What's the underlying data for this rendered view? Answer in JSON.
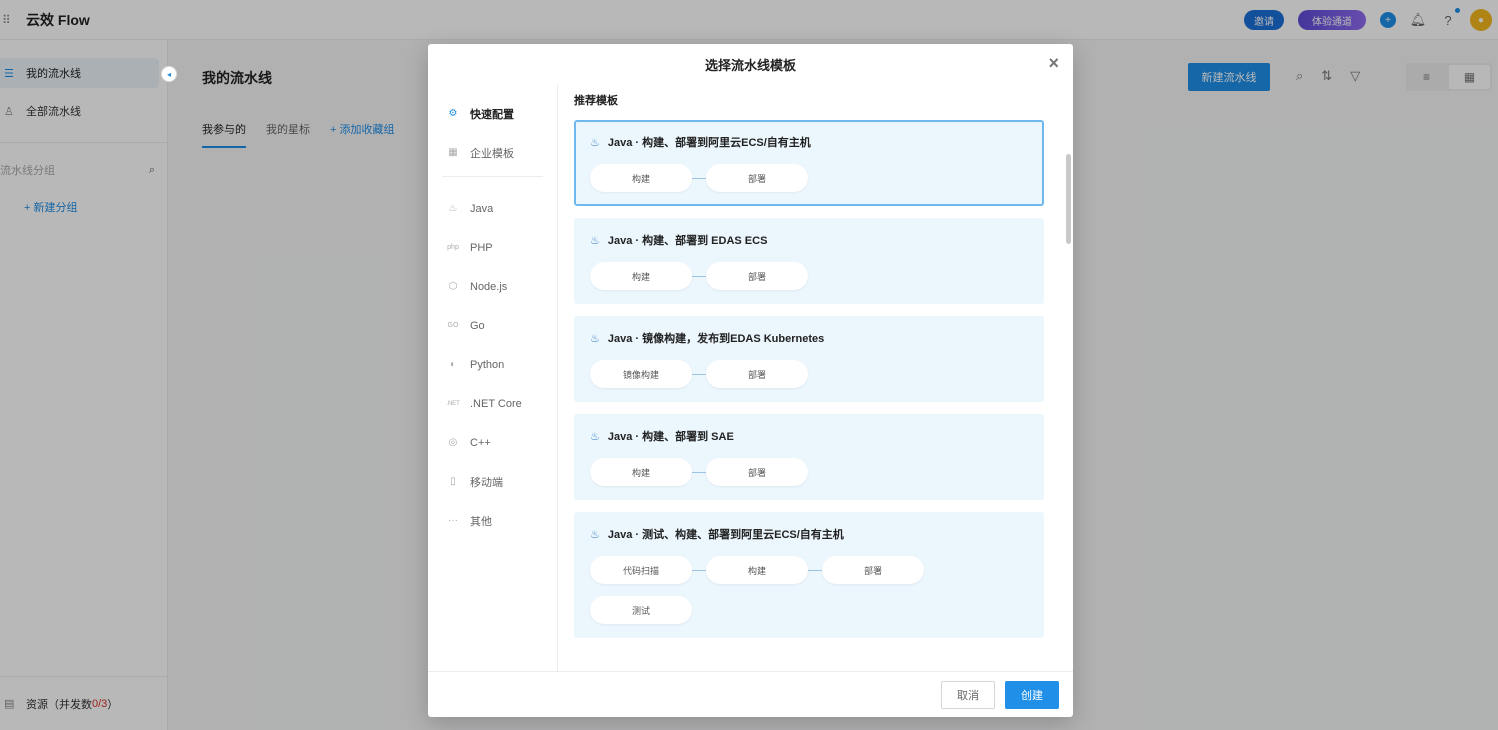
{
  "app": {
    "title": "云效 Flow"
  },
  "topbar": {
    "pill1": "邀请",
    "pill2": "体验通道"
  },
  "sidebar": {
    "items": [
      {
        "label": "我的流水线"
      },
      {
        "label": "全部流水线"
      }
    ],
    "group_search_placeholder": "流水线分组",
    "new_group": "+ 新建分组",
    "resources_label": "资源（并发数",
    "resources_count": "0/3",
    "resources_suffix": "）"
  },
  "main": {
    "title": "我的流水线",
    "tabs": [
      {
        "label": "我参与的"
      },
      {
        "label": "我的星标"
      }
    ],
    "add_favorite": "+ 添加收藏组",
    "new_pipeline": "新建流水线"
  },
  "modal": {
    "title": "选择流水线模板",
    "section_title": "推荐模板",
    "categories": [
      {
        "label": "快速配置",
        "icon": "gear-icon"
      },
      {
        "label": "企业模板",
        "icon": "grid-icon"
      },
      {
        "label": "Java",
        "icon": "java-icon"
      },
      {
        "label": "PHP",
        "icon": "php-icon"
      },
      {
        "label": "Node.js",
        "icon": "nodejs-icon"
      },
      {
        "label": "Go",
        "icon": "go-icon"
      },
      {
        "label": "Python",
        "icon": "python-icon"
      },
      {
        "label": ".NET Core",
        "icon": "dotnet-icon"
      },
      {
        "label": "C++",
        "icon": "cpp-icon"
      },
      {
        "label": "移动端",
        "icon": "mobile-icon"
      },
      {
        "label": "其他",
        "icon": "more-icon"
      }
    ],
    "templates": [
      {
        "title": "Java · 构建、部署到阿里云ECS/自有主机",
        "stages": [
          "构建",
          "部署"
        ]
      },
      {
        "title": "Java · 构建、部署到 EDAS ECS",
        "stages": [
          "构建",
          "部署"
        ]
      },
      {
        "title": "Java · 镜像构建，发布到EDAS Kubernetes",
        "stages": [
          "镜像构建",
          "部署"
        ]
      },
      {
        "title": "Java · 构建、部署到 SAE",
        "stages": [
          "构建",
          "部署"
        ]
      },
      {
        "title": "Java · 测试、构建、部署到阿里云ECS/自有主机",
        "stages": [
          "代码扫描",
          "构建",
          "部署"
        ],
        "extra_stage": "测试"
      }
    ],
    "cancel": "取消",
    "create": "创建"
  },
  "colors": {
    "accent": "#1f8fe8",
    "card_bg": "#ebf6fd"
  }
}
